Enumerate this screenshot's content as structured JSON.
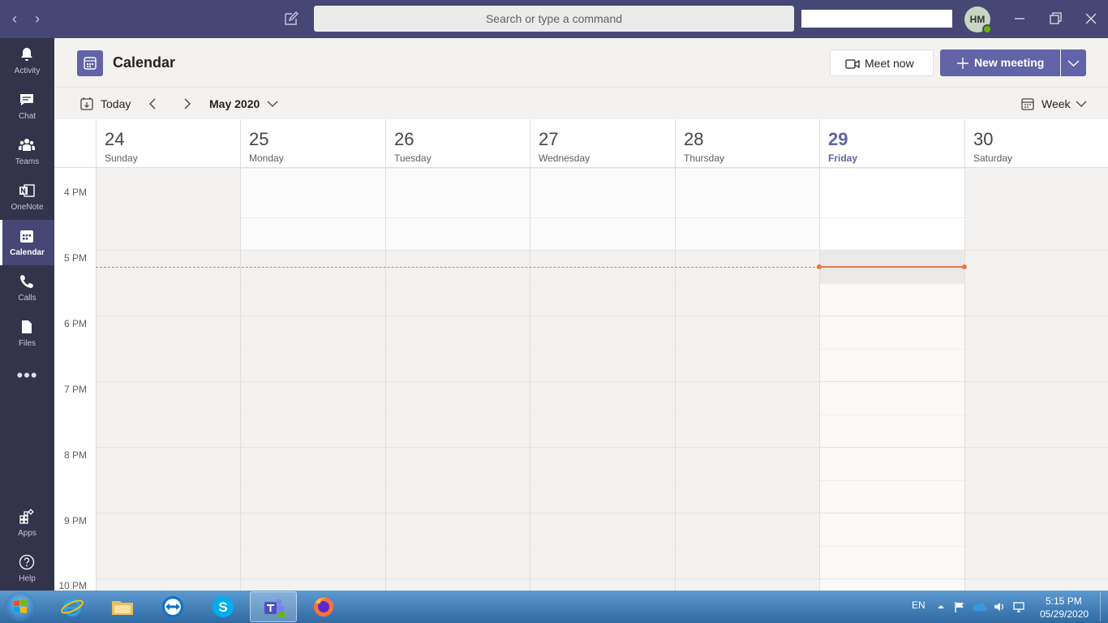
{
  "titlebar": {
    "search_placeholder": "Search or type a command",
    "avatar_initials": "HM"
  },
  "rail": {
    "items": [
      {
        "label": "Activity",
        "icon": "bell-icon"
      },
      {
        "label": "Chat",
        "icon": "chat-icon"
      },
      {
        "label": "Teams",
        "icon": "teams-icon"
      },
      {
        "label": "OneNote",
        "icon": "onenote-icon"
      },
      {
        "label": "Calendar",
        "icon": "calendar-icon",
        "active": true
      },
      {
        "label": "Calls",
        "icon": "phone-icon"
      },
      {
        "label": "Files",
        "icon": "file-icon"
      }
    ],
    "more": "•••",
    "bottom": [
      {
        "label": "Apps",
        "icon": "apps-icon"
      },
      {
        "label": "Help",
        "icon": "help-icon"
      }
    ]
  },
  "header": {
    "title": "Calendar",
    "meet_now": "Meet now",
    "new_meeting": "New meeting"
  },
  "toolbar": {
    "today": "Today",
    "month": "May 2020",
    "view": "Week"
  },
  "days": [
    {
      "num": "24",
      "name": "Sunday"
    },
    {
      "num": "25",
      "name": "Monday"
    },
    {
      "num": "26",
      "name": "Tuesday"
    },
    {
      "num": "27",
      "name": "Wednesday"
    },
    {
      "num": "28",
      "name": "Thursday"
    },
    {
      "num": "29",
      "name": "Friday",
      "today": true
    },
    {
      "num": "30",
      "name": "Saturday"
    }
  ],
  "times": [
    "4 PM",
    "5 PM",
    "6 PM",
    "7 PM",
    "8 PM",
    "9 PM",
    "10 PM"
  ],
  "taskbar": {
    "lang": "EN",
    "time": "5:15 PM",
    "date": "05/29/2020"
  },
  "colors": {
    "brand": "#6264a7",
    "titlebar": "#464775",
    "rail": "#33344a",
    "now_line": "#e97548"
  }
}
